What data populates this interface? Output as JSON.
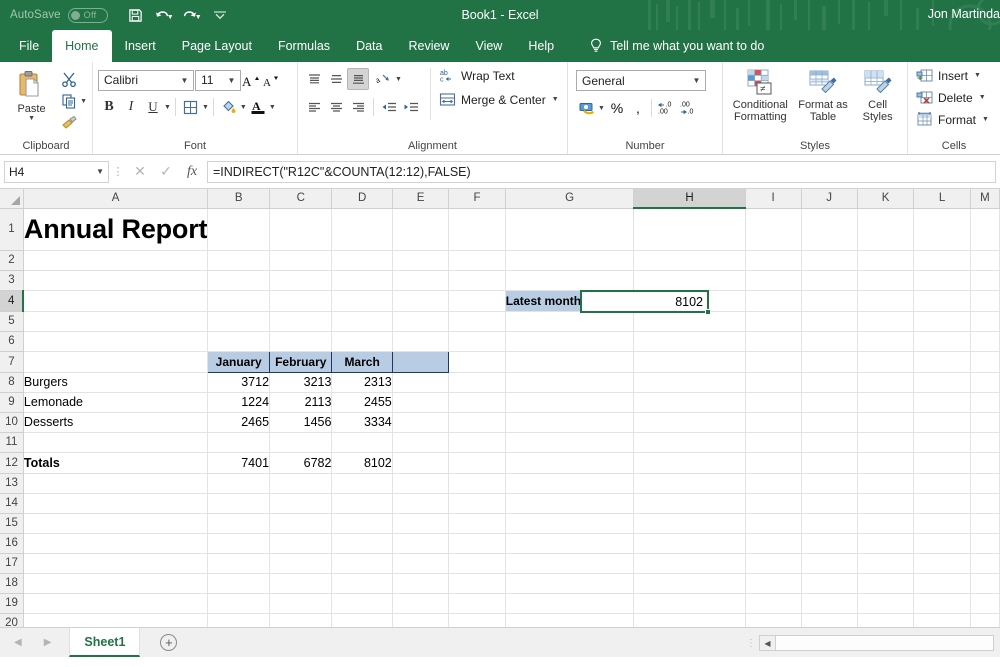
{
  "titlebar": {
    "autosave_label": "AutoSave",
    "autosave_state": "Off",
    "save_icon": "save-icon",
    "undo_icon": "undo-icon",
    "redo_icon": "redo-icon",
    "customize_icon": "customize-quick-access-icon",
    "document_title": "Book1  -  Excel",
    "account_name": "Jon Martinda",
    "brand_color": "#217346"
  },
  "ribbon_tabs": {
    "items": [
      {
        "label": "File",
        "active": false
      },
      {
        "label": "Home",
        "active": true
      },
      {
        "label": "Insert",
        "active": false
      },
      {
        "label": "Page Layout",
        "active": false
      },
      {
        "label": "Formulas",
        "active": false
      },
      {
        "label": "Data",
        "active": false
      },
      {
        "label": "Review",
        "active": false
      },
      {
        "label": "View",
        "active": false
      },
      {
        "label": "Help",
        "active": false
      }
    ],
    "tellme": {
      "icon": "lightbulb-icon",
      "label": "Tell me what you want to do"
    }
  },
  "ribbon": {
    "clipboard": {
      "group_label": "Clipboard",
      "paste_label": "Paste",
      "paste_icon": "paste-icon",
      "cut_icon": "scissors-icon",
      "copy_icon": "copy-icon",
      "format_painter_icon": "format-painter-icon",
      "launcher_icon": "dialog-launcher-icon"
    },
    "font": {
      "group_label": "Font",
      "font_name": "Calibri",
      "font_size": "11",
      "grow_font_icon": "grow-font-icon",
      "shrink_font_icon": "shrink-font-icon",
      "bold_label": "B",
      "italic_label": "I",
      "underline_label": "U",
      "borders_icon": "borders-icon",
      "fill_color_icon": "fill-color-icon",
      "font_color_icon": "font-color-icon",
      "launcher_icon": "dialog-launcher-icon"
    },
    "alignment": {
      "group_label": "Alignment",
      "align_top_icon": "align-top-icon",
      "align_middle_icon": "align-middle-icon",
      "align_bottom_icon": "align-bottom-icon",
      "orientation_icon": "orientation-icon",
      "align_left_icon": "align-left-icon",
      "align_center_icon": "align-center-icon",
      "align_right_icon": "align-right-icon",
      "decrease_indent_icon": "decrease-indent-icon",
      "increase_indent_icon": "increase-indent-icon",
      "wrap_text_label": "Wrap Text",
      "wrap_text_icon": "wrap-text-icon",
      "merge_center_label": "Merge & Center",
      "merge_center_icon": "merge-cells-icon",
      "launcher_icon": "dialog-launcher-icon"
    },
    "number": {
      "group_label": "Number",
      "format": "General",
      "accounting_icon": "accounting-format-icon",
      "percent_label": "%",
      "comma_label": ",",
      "increase_decimal_icon": "increase-decimal-icon",
      "decrease_decimal_icon": "decrease-decimal-icon",
      "launcher_icon": "dialog-launcher-icon"
    },
    "styles": {
      "group_label": "Styles",
      "conditional_formatting_label": "Conditional Formatting",
      "conditional_formatting_icon": "conditional-formatting-icon",
      "format_as_table_label": "Format as Table",
      "format_as_table_icon": "format-as-table-icon",
      "cell_styles_label": "Cell Styles",
      "cell_styles_icon": "cell-styles-icon"
    },
    "cells": {
      "group_label": "Cells",
      "insert_label": "Insert",
      "insert_icon": "insert-cells-icon",
      "delete_label": "Delete",
      "delete_icon": "delete-cells-icon",
      "format_label": "Format",
      "format_icon": "format-cells-icon"
    }
  },
  "formula_bar": {
    "name_box_value": "H4",
    "cancel_icon": "cancel-icon",
    "enter_icon": "confirm-check-icon",
    "function_icon": "insert-function-icon",
    "formula": "=INDIRECT(\"R12C\"&COUNTA(12:12),FALSE)"
  },
  "grid": {
    "columns": [
      {
        "label": "A",
        "width": 100,
        "selected": false
      },
      {
        "label": "B",
        "width": 64,
        "selected": false
      },
      {
        "label": "C",
        "width": 64,
        "selected": false
      },
      {
        "label": "D",
        "width": 64,
        "selected": false
      },
      {
        "label": "E",
        "width": 64,
        "selected": false
      },
      {
        "label": "F",
        "width": 64,
        "selected": false
      },
      {
        "label": "G",
        "width": 130,
        "selected": false
      },
      {
        "label": "H",
        "width": 127,
        "selected": true
      },
      {
        "label": "I",
        "width": 64,
        "selected": false
      },
      {
        "label": "J",
        "width": 64,
        "selected": false
      },
      {
        "label": "K",
        "width": 64,
        "selected": false
      },
      {
        "label": "L",
        "width": 64,
        "selected": false
      },
      {
        "label": "M",
        "width": 30,
        "selected": false
      }
    ],
    "rows": [
      {
        "label": "1",
        "height": 42,
        "selected": false
      },
      {
        "label": "2",
        "height": 20,
        "selected": false
      },
      {
        "label": "3",
        "height": 20,
        "selected": false
      },
      {
        "label": "4",
        "height": 21,
        "selected": true
      },
      {
        "label": "5",
        "height": 20,
        "selected": false
      },
      {
        "label": "6",
        "height": 20,
        "selected": false
      },
      {
        "label": "7",
        "height": 21,
        "selected": false
      },
      {
        "label": "8",
        "height": 20,
        "selected": false
      },
      {
        "label": "9",
        "height": 20,
        "selected": false
      },
      {
        "label": "10",
        "height": 20,
        "selected": false
      },
      {
        "label": "11",
        "height": 20,
        "selected": false
      },
      {
        "label": "12",
        "height": 21,
        "selected": false
      },
      {
        "label": "13",
        "height": 20,
        "selected": false
      },
      {
        "label": "14",
        "height": 20,
        "selected": false
      },
      {
        "label": "15",
        "height": 20,
        "selected": false
      },
      {
        "label": "16",
        "height": 20,
        "selected": false
      },
      {
        "label": "17",
        "height": 20,
        "selected": false
      },
      {
        "label": "18",
        "height": 20,
        "selected": false
      },
      {
        "label": "19",
        "height": 20,
        "selected": false
      },
      {
        "label": "20",
        "height": 20,
        "selected": false
      }
    ],
    "cells": {
      "A1": {
        "value": "Annual Report",
        "style": "title"
      },
      "G4": {
        "value": "Latest monthly sales",
        "style": "label-blue"
      },
      "H4": {
        "value": "8102",
        "style": "number-selected"
      },
      "B7": {
        "value": "January",
        "style": "header-blue"
      },
      "C7": {
        "value": "February",
        "style": "header-blue"
      },
      "D7": {
        "value": "March",
        "style": "header-blue"
      },
      "E7": {
        "value": "",
        "style": "header-blue"
      },
      "A8": {
        "value": "Burgers",
        "style": "text"
      },
      "B8": {
        "value": "3712",
        "style": "number"
      },
      "C8": {
        "value": "3213",
        "style": "number"
      },
      "D8": {
        "value": "2313",
        "style": "number"
      },
      "A9": {
        "value": "Lemonade",
        "style": "text"
      },
      "B9": {
        "value": "1224",
        "style": "number"
      },
      "C9": {
        "value": "2113",
        "style": "number"
      },
      "D9": {
        "value": "2455",
        "style": "number"
      },
      "A10": {
        "value": "Desserts",
        "style": "text"
      },
      "B10": {
        "value": "2465",
        "style": "number"
      },
      "C10": {
        "value": "1456",
        "style": "number"
      },
      "D10": {
        "value": "3334",
        "style": "number"
      },
      "A12": {
        "value": "Totals",
        "style": "text-bold"
      },
      "B12": {
        "value": "7401",
        "style": "number"
      },
      "C12": {
        "value": "6782",
        "style": "number"
      },
      "D12": {
        "value": "8102",
        "style": "number"
      }
    },
    "selection": {
      "cell": "H4",
      "value": "8102"
    },
    "colors": {
      "selection_border": "#217346",
      "header_fill": "#b8cce4",
      "header_border": "#1f3864",
      "grid_line": "#e3e3e3"
    }
  },
  "sheetbar": {
    "prev_icon": "previous-sheet-icon",
    "next_icon": "next-sheet-icon",
    "tabs": [
      {
        "label": "Sheet1",
        "active": true
      }
    ],
    "add_sheet_icon": "add-sheet-icon",
    "add_sheet_label": "+",
    "scroll_left_icon": "scroll-left-icon",
    "split_handle_icon": "split-handle-icon"
  }
}
